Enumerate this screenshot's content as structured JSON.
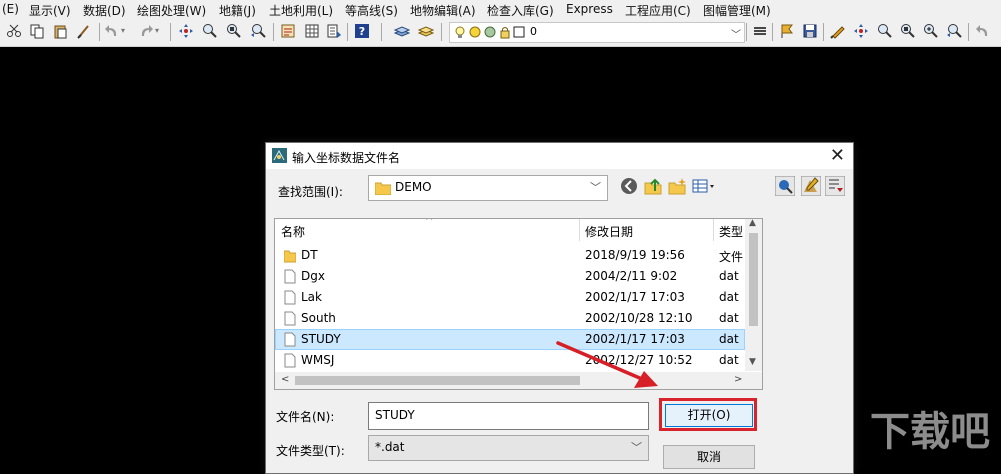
{
  "menu": [
    {
      "label": "(E)"
    },
    {
      "label": "显示(V)"
    },
    {
      "label": "数据(D)"
    },
    {
      "label": "绘图处理(W)"
    },
    {
      "label": "地籍(J)"
    },
    {
      "label": "土地利用(L)"
    },
    {
      "label": "等高线(S)"
    },
    {
      "label": "地物编辑(A)"
    },
    {
      "label": "检查入库(G)"
    },
    {
      "label": "Express"
    },
    {
      "label": "工程应用(C)"
    },
    {
      "label": "图幅管理(M)"
    }
  ],
  "toolbar": {
    "layer_value": "0"
  },
  "dialog": {
    "title": "输入坐标数据文件名",
    "lookin_label": "查找范围(I):",
    "lookin_value": "DEMO",
    "columns": {
      "name": "名称",
      "date": "修改日期",
      "type": "类型"
    },
    "files": [
      {
        "name": "DT",
        "date": "2018/9/19 19:56",
        "type": "文件",
        "kind": "folder"
      },
      {
        "name": "Dgx",
        "date": "2004/2/11 9:02",
        "type": "dat",
        "kind": "file"
      },
      {
        "name": "Lak",
        "date": "2002/1/17 17:03",
        "type": "dat",
        "kind": "file"
      },
      {
        "name": "South",
        "date": "2002/10/28 12:10",
        "type": "dat",
        "kind": "file"
      },
      {
        "name": "STUDY",
        "date": "2002/1/17 17:03",
        "type": "dat",
        "kind": "file",
        "selected": true
      },
      {
        "name": "WMSJ",
        "date": "2002/12/27 10:52",
        "type": "dat",
        "kind": "file"
      }
    ],
    "filename_label": "文件名(N):",
    "filename_value": "STUDY",
    "filetype_label": "文件类型(T):",
    "filetype_value": "*.dat",
    "open_button": "打开(O)",
    "cancel_button": "取消"
  },
  "watermark": "下载吧",
  "colors": {
    "highlight": "#d9232c",
    "arrow": "#d61f26",
    "selection": "#cce8ff"
  }
}
